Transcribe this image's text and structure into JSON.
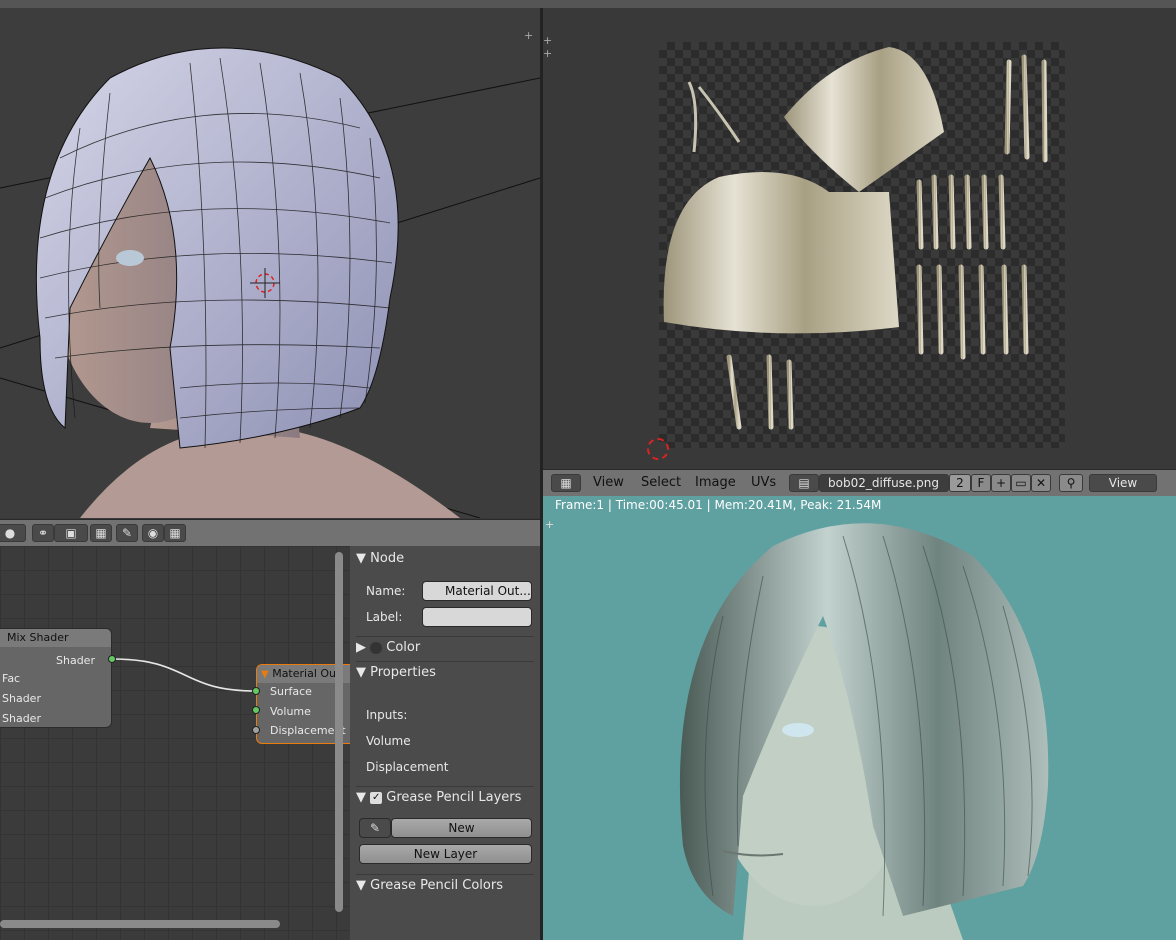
{
  "image_editor": {
    "menus": [
      "View",
      "Select",
      "Image",
      "UVs"
    ],
    "image_name": "bob02_diffuse.png",
    "users_count": "2",
    "fake_user": "F",
    "view_mode": "View"
  },
  "render": {
    "status": "Frame:1 | Time:00:45.01 | Mem:20.41M, Peak: 21.54M"
  },
  "nodes": {
    "mix_shader": {
      "title": "Mix Shader",
      "output": "Shader",
      "inputs": [
        "Fac",
        "Shader",
        "Shader"
      ]
    },
    "material_output": {
      "title": "Material Out",
      "inputs": [
        "Surface",
        "Volume",
        "Displacement"
      ]
    }
  },
  "npanel": {
    "node_header": "Node",
    "name_label": "Name:",
    "name_value": "Material Out...",
    "label_label": "Label:",
    "color_header": "Color",
    "properties_header": "Properties",
    "properties_items": [
      "Inputs:",
      "Volume",
      "Displacement"
    ],
    "grease_layers_header": "Grease Pencil Layers",
    "new_label": "New",
    "new_layer_label": "New Layer",
    "grease_colors_header": "Grease Pencil Colors"
  },
  "colors": {
    "accent_orange": "#e87d0d",
    "socket_green": "#63c763",
    "render_bg": "#5fa0a0"
  }
}
